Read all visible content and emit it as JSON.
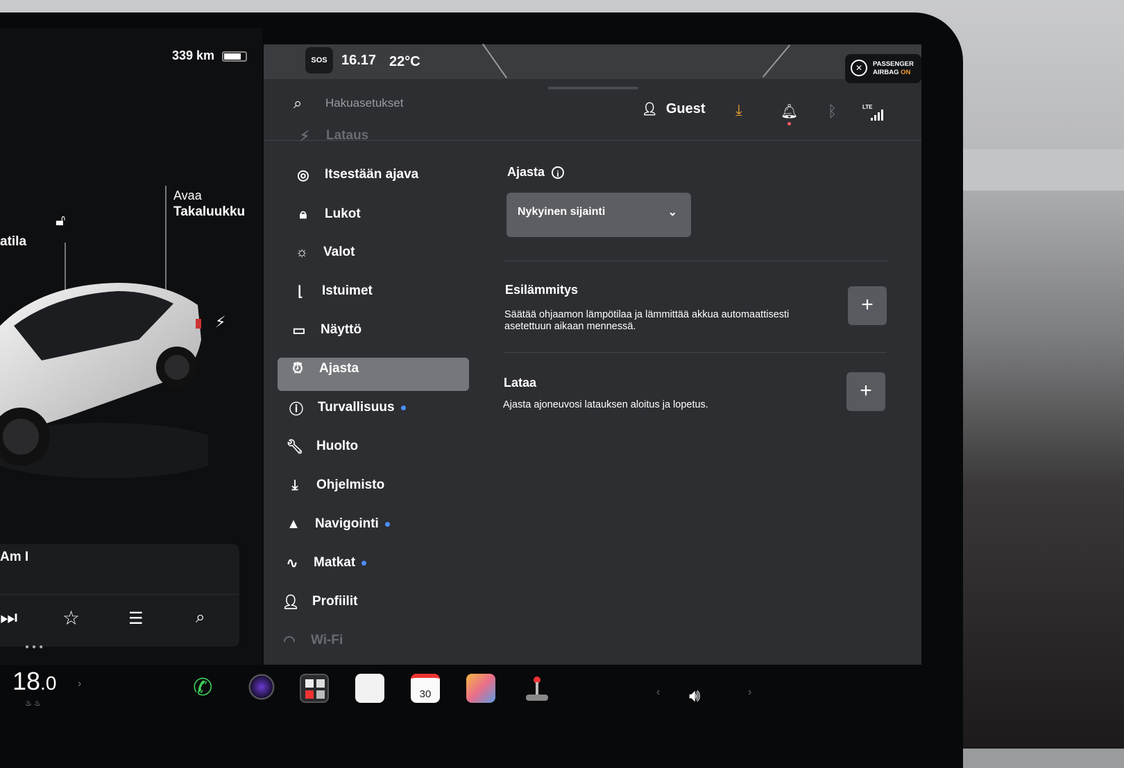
{
  "status": {
    "range": "339 km",
    "sos": "SOS",
    "time": "16.17",
    "temperature": "22°C",
    "airbag_line1": "PASSENGER",
    "airbag_line2_prefix": "AIRBAG",
    "airbag_state": "ON"
  },
  "car": {
    "label_left": "atila",
    "label_trunk_line1": "Avaa",
    "label_trunk_line2": "Takaluukku"
  },
  "music": {
    "song": "Am I"
  },
  "search": {
    "placeholder": "Hakuasetukset"
  },
  "user": {
    "name": "Guest"
  },
  "sidebar": {
    "items": [
      {
        "label": "Lataus",
        "icon": "charge-icon"
      },
      {
        "label": "Itsestään ajava",
        "icon": "steering-wheel-icon"
      },
      {
        "label": "Lukot",
        "icon": "lock-icon"
      },
      {
        "label": "Valot",
        "icon": "light-icon"
      },
      {
        "label": "Istuimet",
        "icon": "seat-icon"
      },
      {
        "label": "Näyttö",
        "icon": "display-icon"
      },
      {
        "label": "Ajasta",
        "icon": "alarm-clock-icon",
        "active": true
      },
      {
        "label": "Turvallisuus",
        "icon": "alert-circle-icon",
        "dot": true
      },
      {
        "label": "Huolto",
        "icon": "wrench-icon"
      },
      {
        "label": "Ohjelmisto",
        "icon": "download-icon"
      },
      {
        "label": "Navigointi",
        "icon": "navigation-icon",
        "dot": true
      },
      {
        "label": "Matkat",
        "icon": "trips-icon",
        "dot": true
      },
      {
        "label": "Profiilit",
        "icon": "profile-icon"
      },
      {
        "label": "Wi-Fi",
        "icon": "wifi-icon"
      }
    ]
  },
  "content": {
    "schedule_title": "Ajasta",
    "location_select": "Nykyinen sijainti",
    "preheat_title": "Esilämmitys",
    "preheat_desc_1": "Säätää ohjaamon lämpötilaa ja lämmittää akkua automaattisesti",
    "preheat_desc_2": "asetettuun aikaan mennessä.",
    "charge_title": "Lataa",
    "charge_desc": "Ajasta ajoneuvosi latauksen aloitus ja lopetus."
  },
  "dock": {
    "temp_whole": "18",
    "temp_decimal": ".0",
    "calendar_day": "30"
  },
  "colors": {
    "accent": "#f0a030",
    "dot": "#4c8eff",
    "active": "#76777c"
  }
}
